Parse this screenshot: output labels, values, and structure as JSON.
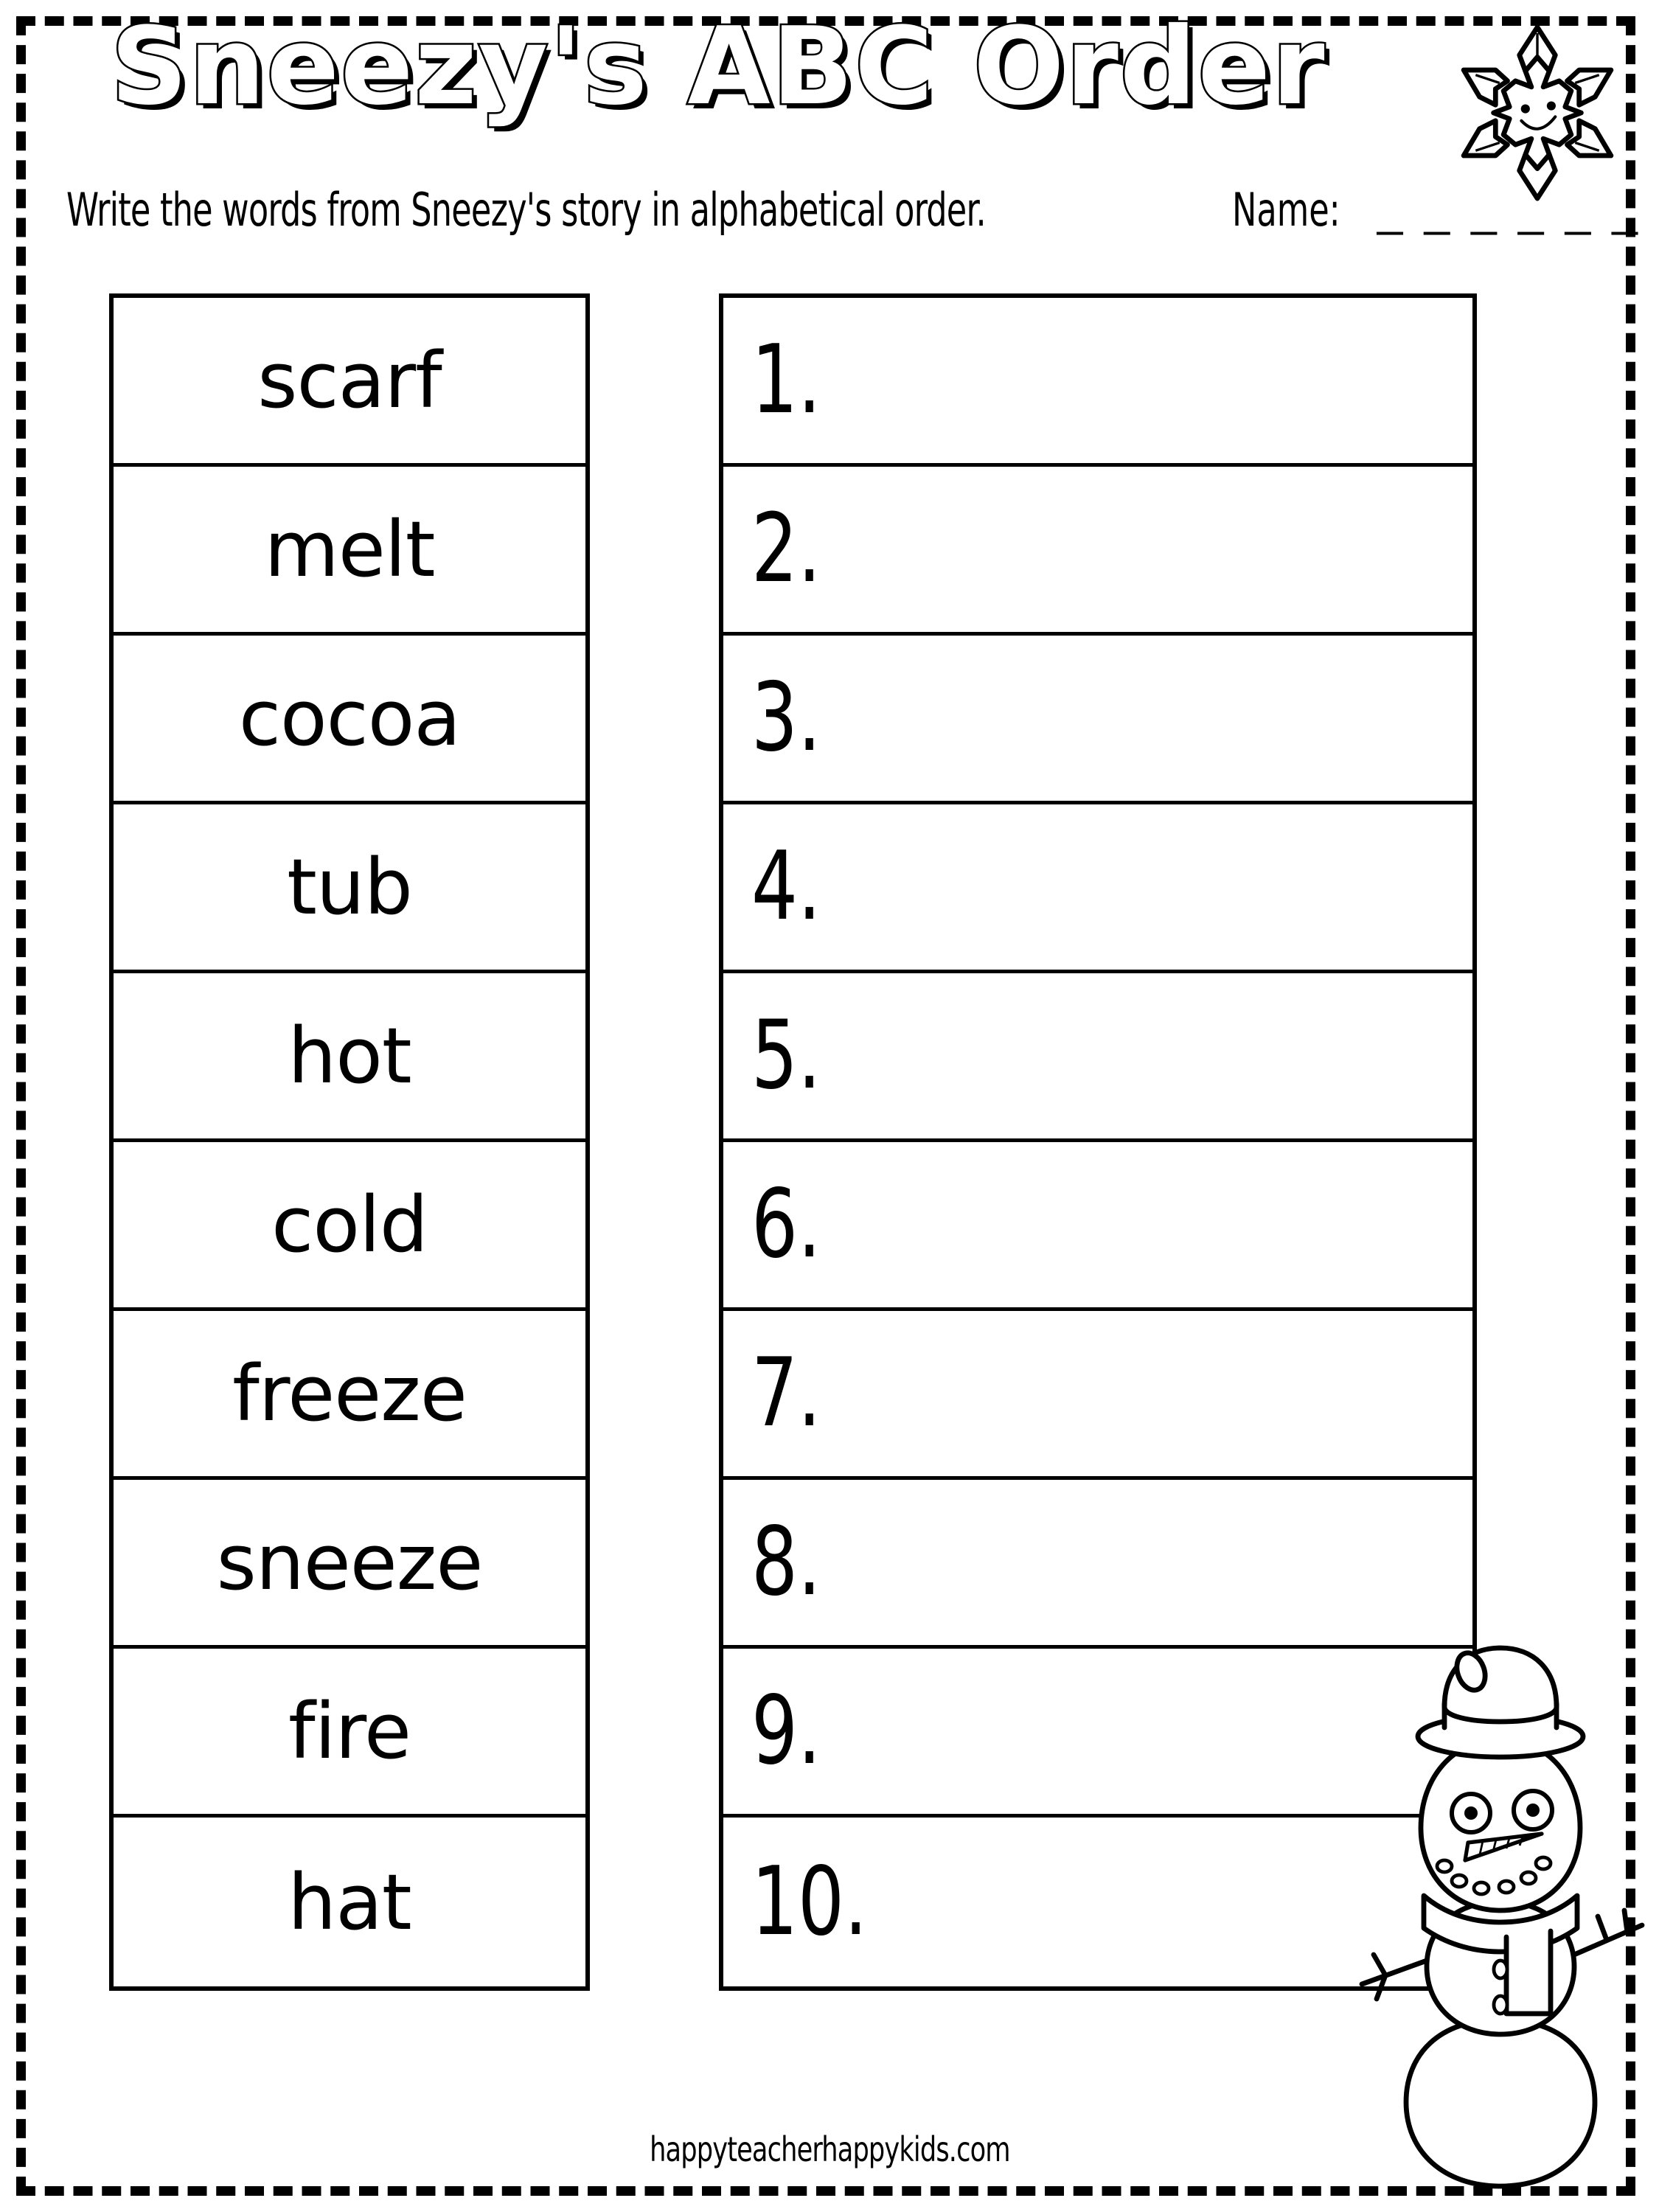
{
  "page": {
    "background_color": "#ffffff",
    "ink_color": "#000000",
    "border_style": "dashed-cut-line"
  },
  "header": {
    "title": "Sneezy's ABC Order",
    "instruction": "Write the words from Sneezy's story in alphabetical order.",
    "name_label": "Name:",
    "name_blank": "_ _ _ _ _ _",
    "snowflake_icon": "smiling-snowflake-icon"
  },
  "word_bank": {
    "column_label": "word-bank",
    "words": [
      "scarf",
      "melt",
      "cocoa",
      "tub",
      "hot",
      "cold",
      "freeze",
      "sneeze",
      "fire",
      "hat"
    ]
  },
  "answer_list": {
    "column_label": "abc-order-answers",
    "numbers": [
      "1.",
      "2.",
      "3.",
      "4.",
      "5.",
      "6.",
      "7.",
      "8.",
      "9.",
      "10."
    ],
    "answers": [
      "",
      "",
      "",
      "",
      "",
      "",
      "",
      "",
      "",
      ""
    ]
  },
  "decorations": {
    "snowman_icon": "snowman-clipart",
    "snowman_parts": [
      "bowler-hat",
      "eyes",
      "carrot-nose",
      "coal-mouth",
      "scarf",
      "stick-arms",
      "buttons"
    ]
  },
  "footer": {
    "credit": "happyteacherhappykids.com"
  }
}
